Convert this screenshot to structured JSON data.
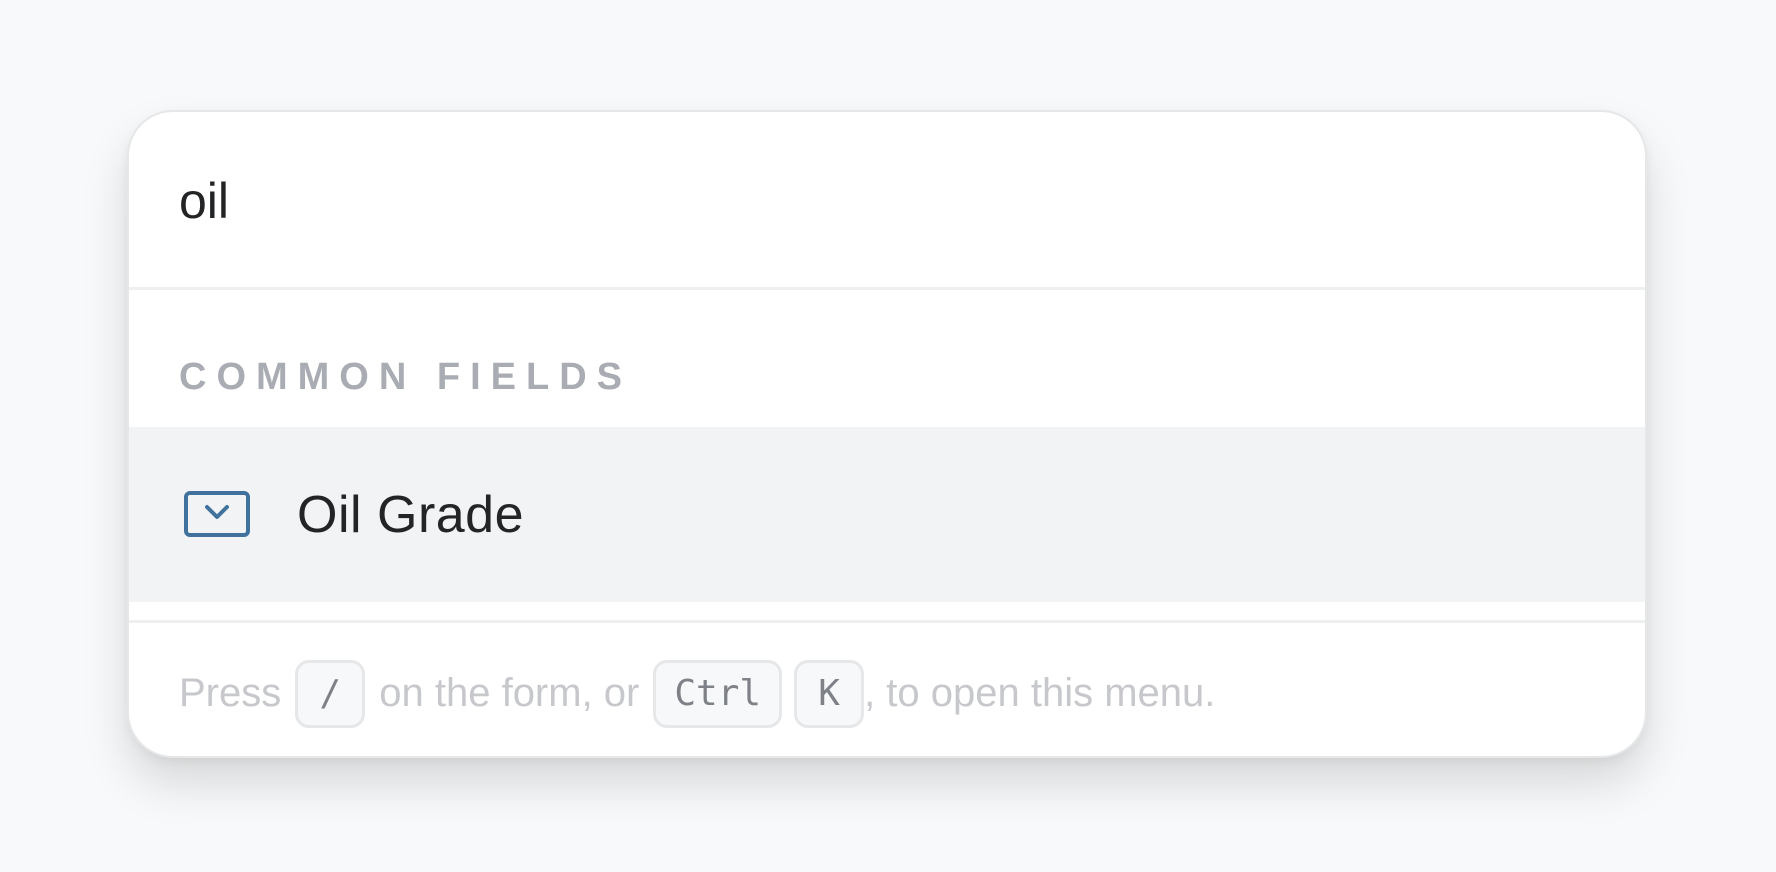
{
  "search": {
    "value": "oil"
  },
  "section": {
    "heading": "COMMON FIELDS"
  },
  "results": [
    {
      "label": "Oil Grade",
      "icon": "dropdown-field-icon",
      "highlighted": true
    }
  ],
  "footer": {
    "prefix": "Press",
    "key_slash": "/",
    "middle": "on the form, or",
    "key_ctrl": "Ctrl",
    "key_k": "K",
    "suffix": ", to open this menu."
  },
  "colors": {
    "icon_accent": "#41729e",
    "highlight_bg": "#f2f3f4",
    "heading_text": "#a9adb3",
    "hint_text": "#c6c8cc"
  }
}
